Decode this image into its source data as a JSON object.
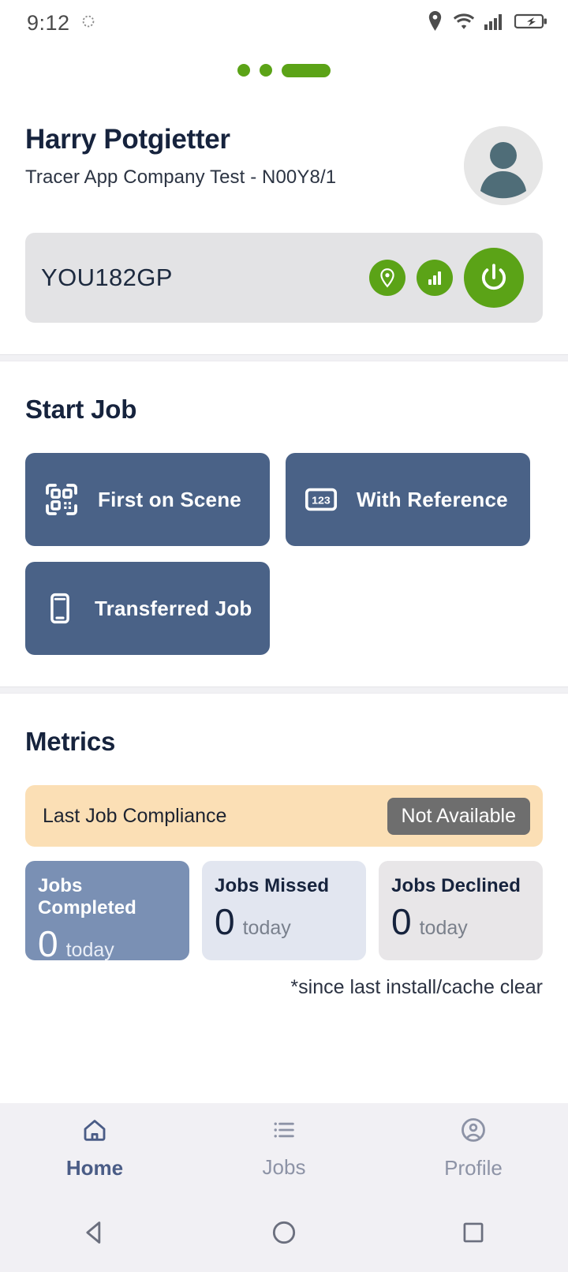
{
  "statusbar": {
    "time": "9:12",
    "icons": [
      "alarm-circle-icon",
      "location-pin-icon",
      "wifi-icon",
      "signal-bars-icon",
      "battery-charging-icon"
    ]
  },
  "pager": {
    "dots": [
      "inactive",
      "inactive",
      "active"
    ],
    "accent_color": "#5ba317"
  },
  "profile": {
    "name": "Harry Potgietter",
    "company": "Tracer App Company Test - N00Y8/1",
    "avatar_alt": "user-avatar",
    "registration": "YOU182GP",
    "actions": [
      {
        "name": "location-icon",
        "label": "Location"
      },
      {
        "name": "signal-icon",
        "label": "Signal"
      },
      {
        "name": "power-icon",
        "label": "Power"
      }
    ]
  },
  "start_job": {
    "title": "Start Job",
    "buttons": [
      {
        "label": "First on Scene",
        "icon": "qr-scan-icon"
      },
      {
        "label": "With Reference",
        "icon": "numbers-123-icon"
      },
      {
        "label": "Transferred Job",
        "icon": "mobile-phone-icon"
      }
    ]
  },
  "metrics": {
    "title": "Metrics",
    "compliance": {
      "label": "Last Job Compliance",
      "status": "Not Available",
      "bar_color": "#fbdfb5",
      "badge_color": "#6e6e6e"
    },
    "cards": [
      {
        "label": "Jobs Completed",
        "value": "0",
        "unit": "today",
        "color": "#7a90b4"
      },
      {
        "label": "Jobs Missed",
        "value": "0",
        "unit": "today",
        "color": "#e2e6f0"
      },
      {
        "label": "Jobs Declined",
        "value": "0",
        "unit": "today",
        "color": "#e8e6e8"
      }
    ],
    "footnote": "*since last install/cache clear"
  },
  "bottom_nav": {
    "items": [
      {
        "label": "Home",
        "icon": "home-icon",
        "active": true
      },
      {
        "label": "Jobs",
        "icon": "list-icon",
        "active": false
      },
      {
        "label": "Profile",
        "icon": "account-circle-icon",
        "active": false
      }
    ],
    "active_color": "#4a5c86",
    "inactive_color": "#8d93a6"
  },
  "system_nav": {
    "buttons": [
      "back-triangle-icon",
      "home-circle-icon",
      "recents-square-icon"
    ]
  }
}
